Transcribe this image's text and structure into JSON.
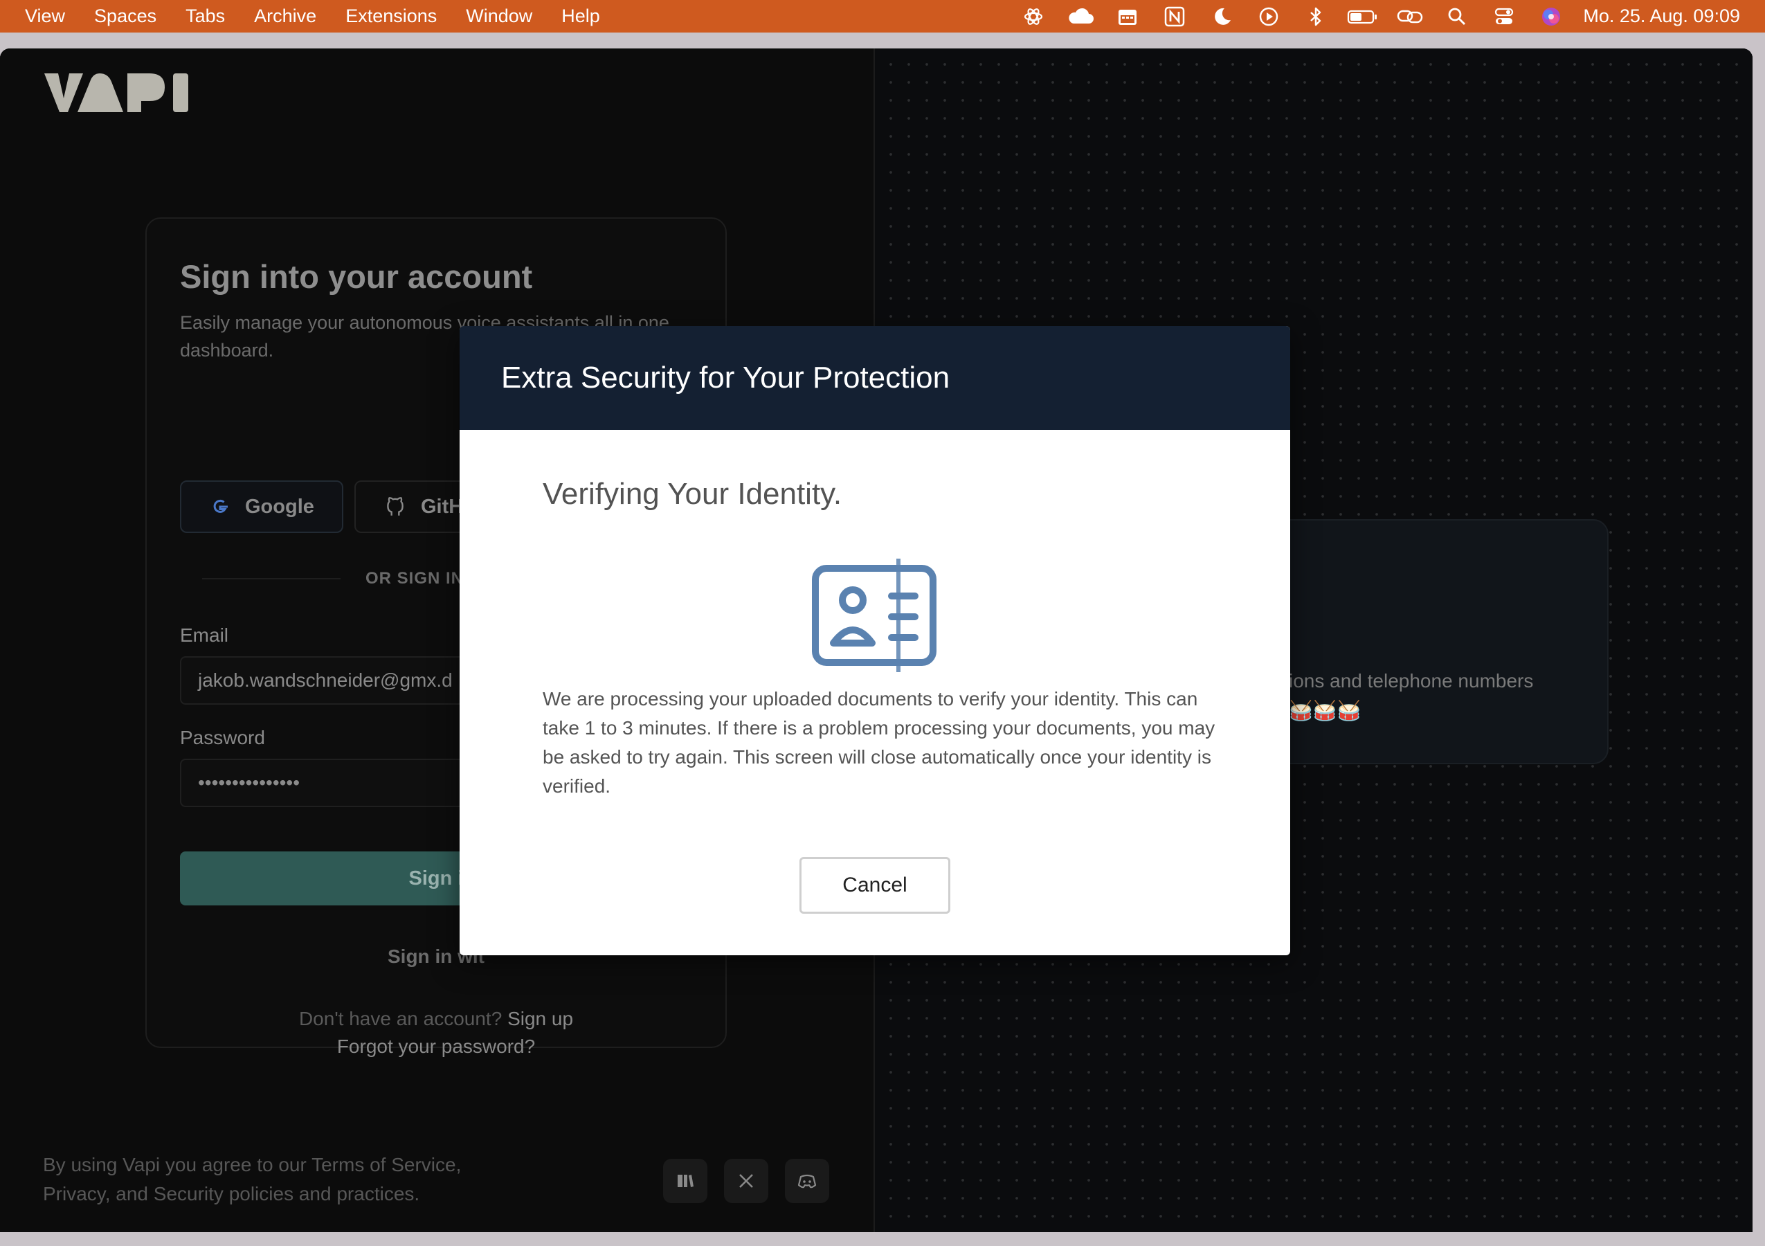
{
  "menubar": {
    "items": [
      "View",
      "Spaces",
      "Tabs",
      "Archive",
      "Extensions",
      "Window",
      "Help"
    ],
    "clock": "Mo. 25. Aug.  09:09",
    "bg_color": "#cf5a1f"
  },
  "login": {
    "title": "Sign into your account",
    "subtitle": "Easily manage your autonomous voice assistants all in one dashboard.",
    "oauth": {
      "google": "Google",
      "github": "GitH"
    },
    "divider": "OR SIGN IN",
    "email_label": "Email",
    "email_value": "jakob.wandschneider@gmx.d",
    "password_label": "Password",
    "password_value": "•••••••••••••••",
    "signin_button": "Sign i",
    "signin_with": "Sign in wit",
    "no_account": "Don't have an account?",
    "signup": "Sign up",
    "forgot": "Forgot your password?",
    "terms": "By using Vapi you agree to our Terms of Service, Privacy, and Security policies and practices."
  },
  "feature": {
    "text": "ions and telephone numbers",
    "emoji": "🥁🥁🥁"
  },
  "modal": {
    "title": "Extra Security for Your Protection",
    "heading": "Verifying Your Identity.",
    "body": "We are processing your uploaded documents to verify your identity. This can take 1 to 3 minutes. If there is a problem processing your documents, you may be asked to try again. This screen will close automatically once your identity is verified.",
    "cancel": "Cancel",
    "header_color": "#142032",
    "icon_color": "#5a82b0"
  }
}
